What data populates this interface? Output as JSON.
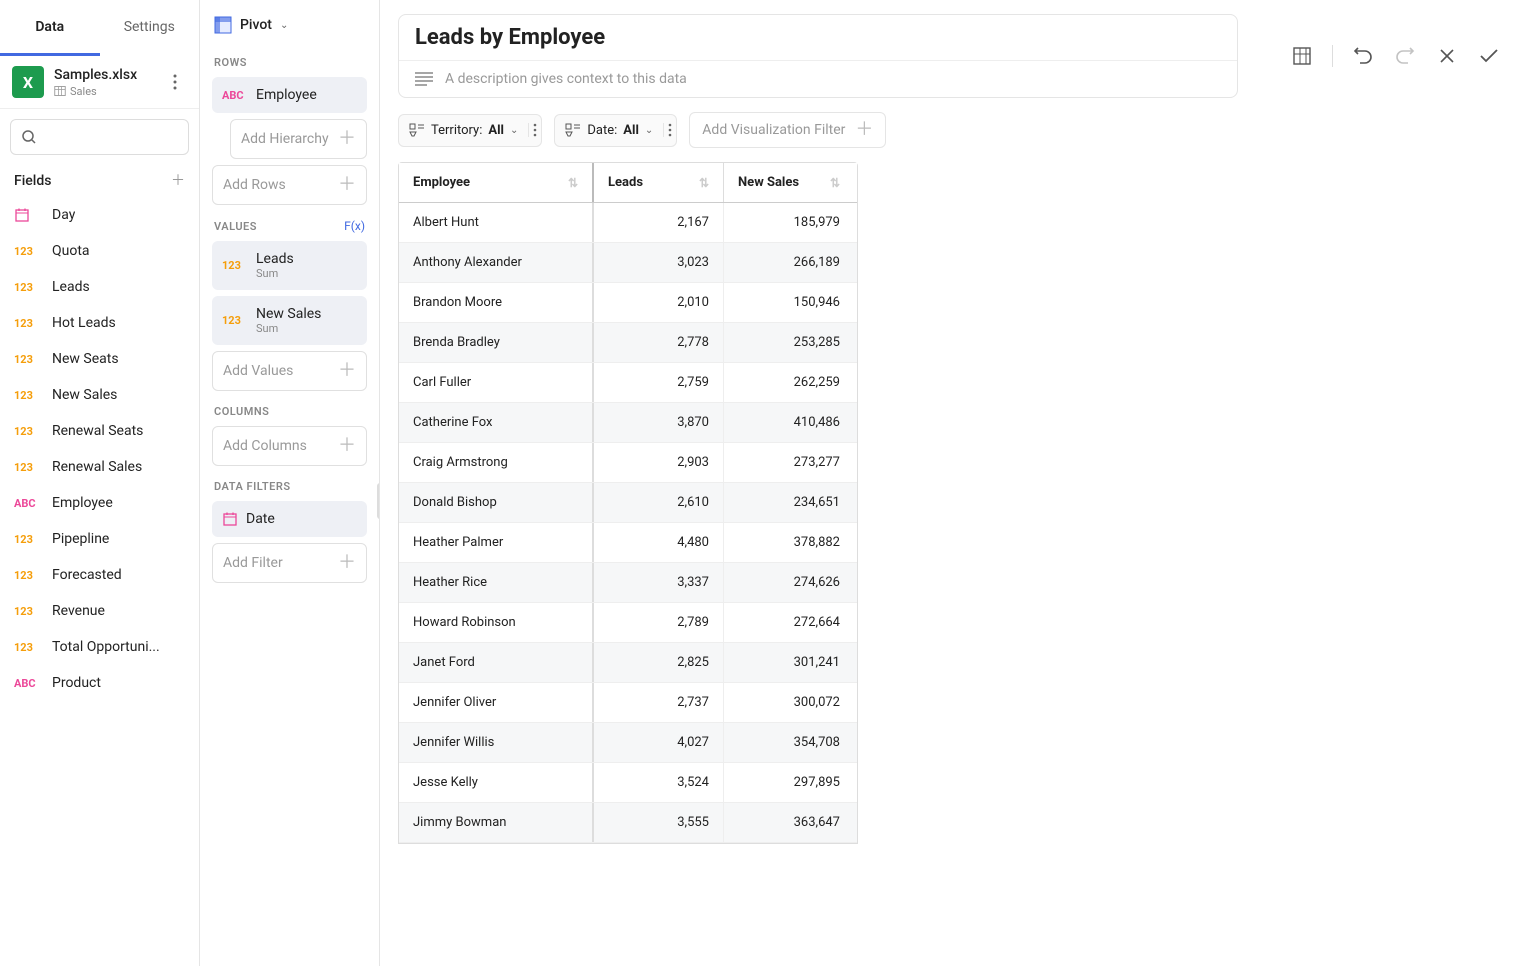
{
  "tabs": {
    "data": "Data",
    "settings": "Settings"
  },
  "file": {
    "name": "Samples.xlsx",
    "sub": "Sales"
  },
  "fieldsHeader": "Fields",
  "fields": [
    {
      "type": "cal",
      "label": "Day"
    },
    {
      "type": "123",
      "label": "Quota"
    },
    {
      "type": "123",
      "label": "Leads"
    },
    {
      "type": "123",
      "label": "Hot Leads"
    },
    {
      "type": "123",
      "label": "New Seats"
    },
    {
      "type": "123",
      "label": "New Sales"
    },
    {
      "type": "123",
      "label": "Renewal Seats"
    },
    {
      "type": "123",
      "label": "Renewal Sales"
    },
    {
      "type": "abc",
      "label": "Employee"
    },
    {
      "type": "123",
      "label": "Pipepline"
    },
    {
      "type": "123",
      "label": "Forecasted"
    },
    {
      "type": "123",
      "label": "Revenue"
    },
    {
      "type": "123",
      "label": "Total Opportuni..."
    },
    {
      "type": "abc",
      "label": "Product"
    }
  ],
  "pivot": {
    "label": "Pivot"
  },
  "sections": {
    "rows": "ROWS",
    "values": "VALUES",
    "fx": "F(x)",
    "columns": "COLUMNS",
    "dataFilters": "DATA FILTERS"
  },
  "rowChips": {
    "employee": "Employee"
  },
  "placeholders": {
    "addHierarchy": "Add Hierarchy",
    "addRows": "Add Rows",
    "addValues": "Add Values",
    "addColumns": "Add Columns",
    "addFilter": "Add Filter"
  },
  "valueChips": [
    {
      "label": "Leads",
      "agg": "Sum"
    },
    {
      "label": "New Sales",
      "agg": "Sum"
    }
  ],
  "filterChips": {
    "date": "Date"
  },
  "main": {
    "title": "Leads by Employee",
    "descPlaceholder": "A description gives context to this data"
  },
  "filters": {
    "territoryLabel": "Territory:",
    "territoryValue": "All",
    "dateLabel": "Date:",
    "dateValue": "All",
    "addVis": "Add Visualization Filter"
  },
  "table": {
    "headers": {
      "employee": "Employee",
      "leads": "Leads",
      "newSales": "New Sales"
    },
    "rows": [
      {
        "emp": "Albert Hunt",
        "leads": "2,167",
        "sales": "185,979"
      },
      {
        "emp": "Anthony Alexander",
        "leads": "3,023",
        "sales": "266,189"
      },
      {
        "emp": "Brandon Moore",
        "leads": "2,010",
        "sales": "150,946"
      },
      {
        "emp": "Brenda Bradley",
        "leads": "2,778",
        "sales": "253,285"
      },
      {
        "emp": "Carl Fuller",
        "leads": "2,759",
        "sales": "262,259"
      },
      {
        "emp": "Catherine Fox",
        "leads": "3,870",
        "sales": "410,486"
      },
      {
        "emp": "Craig Armstrong",
        "leads": "2,903",
        "sales": "273,277"
      },
      {
        "emp": "Donald Bishop",
        "leads": "2,610",
        "sales": "234,651"
      },
      {
        "emp": "Heather Palmer",
        "leads": "4,480",
        "sales": "378,882"
      },
      {
        "emp": "Heather Rice",
        "leads": "3,337",
        "sales": "274,626"
      },
      {
        "emp": "Howard Robinson",
        "leads": "2,789",
        "sales": "272,664"
      },
      {
        "emp": "Janet Ford",
        "leads": "2,825",
        "sales": "301,241"
      },
      {
        "emp": "Jennifer Oliver",
        "leads": "2,737",
        "sales": "300,072"
      },
      {
        "emp": "Jennifer Willis",
        "leads": "4,027",
        "sales": "354,708"
      },
      {
        "emp": "Jesse Kelly",
        "leads": "3,524",
        "sales": "297,895"
      },
      {
        "emp": "Jimmy Bowman",
        "leads": "3,555",
        "sales": "363,647"
      }
    ]
  }
}
